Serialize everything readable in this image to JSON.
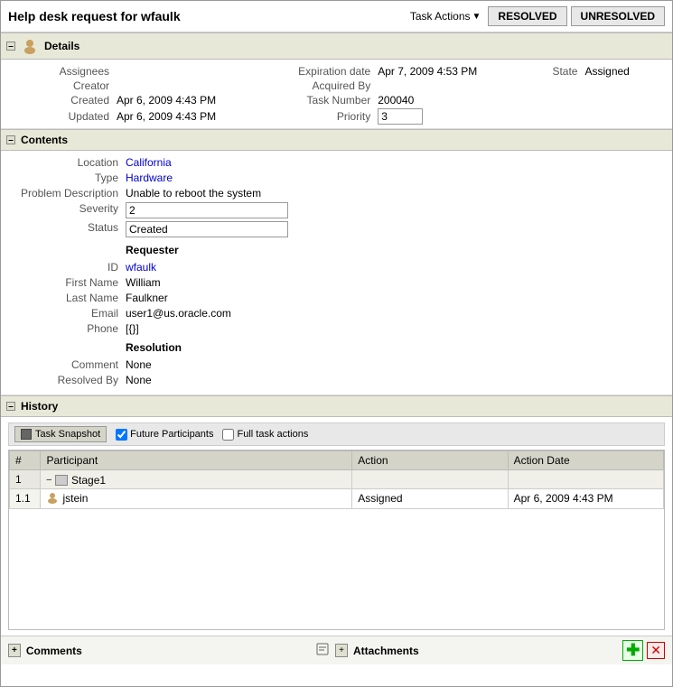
{
  "header": {
    "title": "Help desk request for wfaulk",
    "taskActions": {
      "label": "Task Actions",
      "arrowChar": "▼"
    },
    "resolvedBtn": "RESOLVED",
    "unresolvedBtn": "UNRESOLVED"
  },
  "details": {
    "sectionLabel": "Details",
    "fields": {
      "assignees_label": "Assignees",
      "creator_label": "Creator",
      "created_label": "Created",
      "created_value": "Apr 6, 2009 4:43 PM",
      "updated_label": "Updated",
      "updated_value": "Apr 6, 2009 4:43 PM",
      "expiration_label": "Expiration date",
      "expiration_value": "Apr 7, 2009 4:53 PM",
      "acquired_label": "Acquired By",
      "tasknum_label": "Task Number",
      "tasknum_value": "200040",
      "priority_label": "Priority",
      "priority_value": "3",
      "state_label": "State",
      "state_value": "Assigned"
    }
  },
  "contents": {
    "sectionLabel": "Contents",
    "location_label": "Location",
    "location_value": "California",
    "type_label": "Type",
    "type_value": "Hardware",
    "problem_label": "Problem Description",
    "problem_value": "Unable to reboot the system",
    "severity_label": "Severity",
    "severity_value": "2",
    "status_label": "Status",
    "status_value": "Created",
    "requester_label": "Requester",
    "id_label": "ID",
    "id_value": "wfaulk",
    "firstname_label": "First Name",
    "firstname_value": "William",
    "lastname_label": "Last Name",
    "lastname_value": "Faulkner",
    "email_label": "Email",
    "email_value": "user1@us.oracle.com",
    "phone_label": "Phone",
    "phone_value": "[{}]",
    "resolution_label": "Resolution",
    "comment_label": "Comment",
    "comment_value": "None",
    "resolvedby_label": "Resolved By",
    "resolvedby_value": "None"
  },
  "history": {
    "sectionLabel": "History",
    "toolbar": {
      "snapshotBtn": "Task Snapshot",
      "futureLabel": "Future Participants",
      "fullLabel": "Full task actions"
    },
    "table": {
      "col_num": "#",
      "col_participant": "Participant",
      "col_action": "Action",
      "col_date": "Action Date"
    },
    "rows": [
      {
        "num": "1",
        "participant": "Stage1",
        "action": "",
        "date": "",
        "type": "stage"
      },
      {
        "num": "1.1",
        "participant": "jstein",
        "action": "Assigned",
        "date": "Apr 6, 2009 4:43 PM",
        "type": "person"
      }
    ]
  },
  "footer": {
    "comments_label": "Comments",
    "attachments_label": "Attachments",
    "add_icon": "✚",
    "remove_icon": "✕"
  }
}
